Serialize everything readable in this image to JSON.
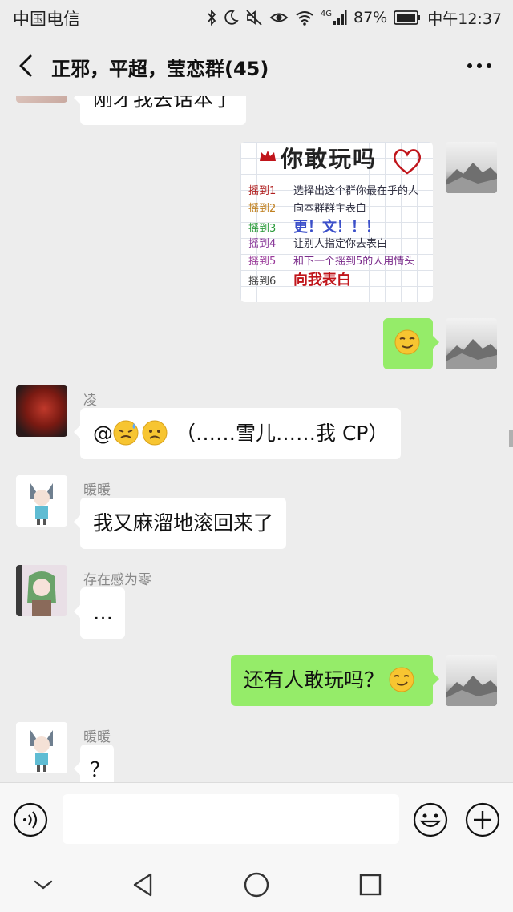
{
  "status_bar": {
    "carrier": "中国电信",
    "network": "4G",
    "battery": "87%",
    "time": "中午12:37"
  },
  "header": {
    "title": "正邪，平超，莹恋群(45)"
  },
  "messages": {
    "partial_top": {
      "text": "刚才我去话本了"
    },
    "image_sticker": {
      "title": "你敢玩吗",
      "rows": [
        {
          "roll": "摇到1",
          "task": "选择出这个群你最在乎的人"
        },
        {
          "roll": "摇到2",
          "task": "向本群群主表白"
        },
        {
          "roll": "摇到3",
          "task": "更！文！！！"
        },
        {
          "roll": "摇到4",
          "task": "让别人指定你去表白"
        },
        {
          "roll": "摇到5",
          "task": "和下一个摇到5的人用情头"
        },
        {
          "roll": "摇到6",
          "task": "向我表白"
        }
      ]
    },
    "ling": {
      "sender": "凌",
      "prefix": "@",
      "text": "（……雪儿……我 CP）"
    },
    "nuannuan1": {
      "sender": "暖暖",
      "text": "我又麻溜地滚回来了"
    },
    "cunzai": {
      "sender": "存在感为零",
      "text": "…"
    },
    "self_text": {
      "text": "还有人敢玩吗？"
    },
    "nuannuan2": {
      "sender": "暖暖",
      "text": "？"
    }
  },
  "input_bar": {
    "placeholder": ""
  },
  "colors": {
    "background": "#ededed",
    "self_bubble": "#95ec69",
    "other_bubble": "#ffffff"
  },
  "icons": [
    "back-icon",
    "more-icon",
    "voice-icon",
    "emoji-icon",
    "plus-icon",
    "nav-back-icon",
    "nav-home-icon",
    "nav-recents-icon",
    "nav-collapse-icon"
  ]
}
